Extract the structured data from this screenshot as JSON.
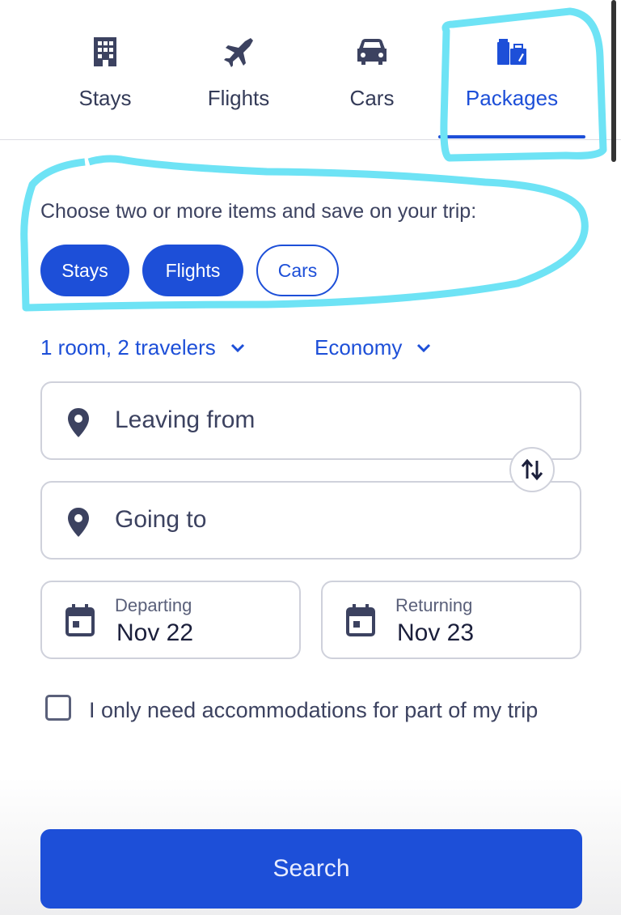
{
  "tabs": [
    {
      "label": "Stays",
      "icon": "building-icon",
      "active": false
    },
    {
      "label": "Flights",
      "icon": "airplane-icon",
      "active": false
    },
    {
      "label": "Cars",
      "icon": "car-icon",
      "active": false
    },
    {
      "label": "Packages",
      "icon": "luggage-icon",
      "active": true
    }
  ],
  "packages": {
    "prompt": "Choose two or more items and save on your trip:",
    "chips": [
      {
        "label": "Stays",
        "selected": true
      },
      {
        "label": "Flights",
        "selected": true
      },
      {
        "label": "Cars",
        "selected": false
      }
    ]
  },
  "travelers": {
    "label": "1 room, 2 travelers"
  },
  "cabin": {
    "label": "Economy"
  },
  "origin": {
    "placeholder": "Leaving from"
  },
  "destination": {
    "placeholder": "Going to"
  },
  "departing": {
    "label": "Departing",
    "value": "Nov 22"
  },
  "returning": {
    "label": "Returning",
    "value": "Nov 23"
  },
  "partial_stay": {
    "label": "I only need accommodations for part of my trip",
    "checked": false
  },
  "search": {
    "label": "Search"
  },
  "colors": {
    "accent": "#1d4fd8",
    "highlight": "#6ee3f5",
    "text": "#3c4260"
  }
}
